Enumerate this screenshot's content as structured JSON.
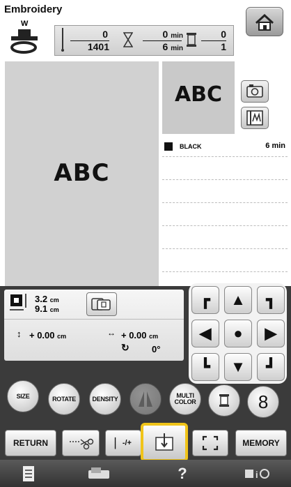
{
  "header": {
    "title": "Embroidery",
    "presser_foot": "W",
    "stitch_current": "0",
    "stitch_total": "1401",
    "time_current": "0",
    "time_total": "6",
    "time_unit": "min",
    "color_current": "0",
    "color_total": "1"
  },
  "preview": {
    "pattern_text": "ABC"
  },
  "color_list": [
    {
      "name": "BLACK",
      "time": "6 min",
      "swatch": "#111111"
    }
  ],
  "info": {
    "width": "3.2",
    "height": "9.1",
    "unit": "cm",
    "vertical_offset": "+ 0.00",
    "horizontal_offset": "+ 0.00",
    "rotation": "0°"
  },
  "edit_buttons": {
    "size": "SIZE",
    "rotate": "ROTATE",
    "density": "DENSITY",
    "multi_color": "MULTI COLOR"
  },
  "action_buttons": {
    "return": "RETURN",
    "memory": "MEMORY",
    "stitch_adjust": "-/+"
  },
  "footer": {
    "help": "?"
  },
  "colors": {
    "highlight": "#f0c419",
    "panel": "#3b3b3b"
  }
}
